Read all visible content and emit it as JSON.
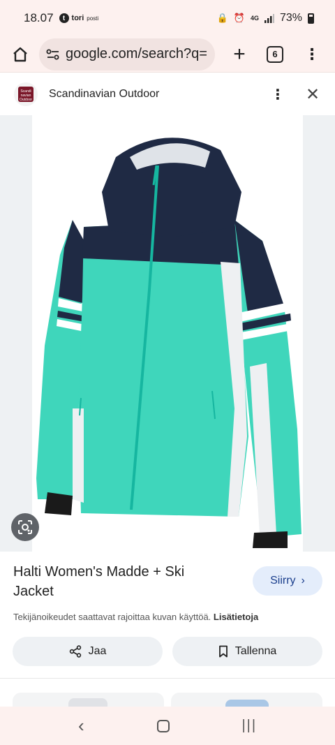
{
  "status_bar": {
    "time": "18.07",
    "notification_app": "tori",
    "notification_sub": "posti",
    "network": "4G",
    "battery": "73%"
  },
  "browser": {
    "url": "google.com/search?q=",
    "tab_count": "6"
  },
  "source": {
    "name": "Scandinavian Outdoor",
    "logo_text": "Scandinavian Outdoor"
  },
  "product": {
    "title": "Halti Women's Madde + Ski Jacket",
    "visit_label": "Siirry",
    "copyright_text": "Tekijänoikeudet saattavat rajoittaa kuvan käyttöä.",
    "copyright_link": "Lisätietoja"
  },
  "actions": {
    "share_label": "Jaa",
    "save_label": "Tallenna"
  },
  "colors": {
    "jacket_navy": "#1f2a44",
    "jacket_mint": "#3fd6bb",
    "zip_teal": "#16b6a0",
    "accent_blue": "#1a3e8c"
  }
}
